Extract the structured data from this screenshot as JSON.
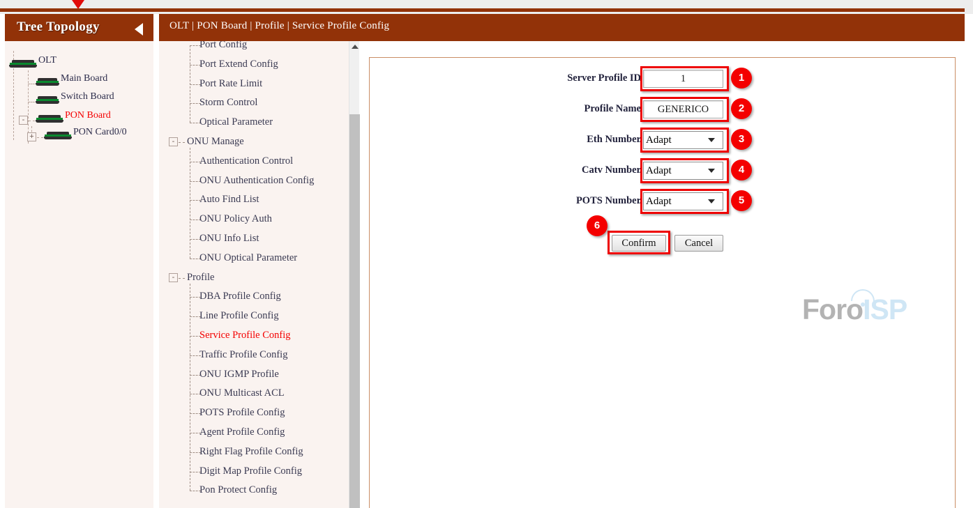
{
  "window": {
    "accent_brown": "#923208",
    "highlight_red": "#f40000",
    "panel_cream": "#faf3f0"
  },
  "tree": {
    "title": "Tree Topology",
    "collapse_icon": "triangle-left-icon",
    "nodes": [
      {
        "label": "OLT",
        "icon": "board-icon",
        "expander": "",
        "active": false
      },
      {
        "label": "Main Board",
        "icon": "board-icon",
        "expander": "",
        "active": false
      },
      {
        "label": "Switch Board",
        "icon": "board-icon",
        "expander": "",
        "active": false
      },
      {
        "label": "PON Board",
        "icon": "board-icon",
        "expander": "-",
        "active": true
      },
      {
        "label": "PON Card0/0",
        "icon": "board-icon",
        "expander": "+",
        "active": false
      }
    ]
  },
  "header": {
    "breadcrumb": "OLT | PON Board | Profile | Service Profile Config"
  },
  "nav": {
    "items": [
      {
        "label": "Port Config",
        "type": "leaf",
        "active": false
      },
      {
        "label": "Port Extend Config",
        "type": "leaf",
        "active": false
      },
      {
        "label": "Port Rate Limit",
        "type": "leaf",
        "active": false
      },
      {
        "label": "Storm Control",
        "type": "leaf",
        "active": false
      },
      {
        "label": "Optical Parameter",
        "type": "leaf",
        "active": false
      },
      {
        "label": "ONU Manage",
        "type": "group",
        "active": false,
        "expander": "-"
      },
      {
        "label": "Authentication Control",
        "type": "leaf",
        "active": false
      },
      {
        "label": "ONU Authentication Config",
        "type": "leaf",
        "active": false
      },
      {
        "label": "Auto Find List",
        "type": "leaf",
        "active": false
      },
      {
        "label": "ONU Policy Auth",
        "type": "leaf",
        "active": false
      },
      {
        "label": "ONU Info List",
        "type": "leaf",
        "active": false
      },
      {
        "label": "ONU Optical Parameter",
        "type": "leaf",
        "active": false
      },
      {
        "label": "Profile",
        "type": "group",
        "active": false,
        "expander": "-"
      },
      {
        "label": "DBA Profile Config",
        "type": "leaf",
        "active": false
      },
      {
        "label": "Line Profile Config",
        "type": "leaf",
        "active": false
      },
      {
        "label": "Service Profile Config",
        "type": "leaf",
        "active": true
      },
      {
        "label": "Traffic Profile Config",
        "type": "leaf",
        "active": false
      },
      {
        "label": "ONU IGMP Profile",
        "type": "leaf",
        "active": false
      },
      {
        "label": "ONU Multicast ACL",
        "type": "leaf",
        "active": false
      },
      {
        "label": "POTS Profile Config",
        "type": "leaf",
        "active": false
      },
      {
        "label": "Agent Profile Config",
        "type": "leaf",
        "active": false
      },
      {
        "label": "Right Flag Profile Config",
        "type": "leaf",
        "active": false
      },
      {
        "label": "Digit Map Profile Config",
        "type": "leaf",
        "active": false
      },
      {
        "label": "Pon Protect Config",
        "type": "leaf",
        "active": false
      }
    ],
    "scroll_up_icon": "triangle-up-icon"
  },
  "watermark": {
    "text_primary": "Foro",
    "text_secondary": "ISP"
  },
  "form": {
    "fields": [
      {
        "label": "Server Profile ID",
        "colon": ":",
        "control": "text",
        "value": "1",
        "badge": "1"
      },
      {
        "label": "Profile Name",
        "colon": ":",
        "control": "text",
        "value": "GENERICO",
        "badge": "2"
      },
      {
        "label": "Eth Number",
        "colon": ":",
        "control": "select",
        "value": "Adapt",
        "badge": "3"
      },
      {
        "label": "Catv Number",
        "colon": ":",
        "control": "select",
        "value": "Adapt",
        "badge": "4"
      },
      {
        "label": "POTS Number",
        "colon": ":",
        "control": "select",
        "value": "Adapt",
        "badge": "5"
      }
    ],
    "select_options": [
      "Adapt"
    ],
    "confirm_label": "Confirm",
    "cancel_label": "Cancel",
    "confirm_badge": "6"
  }
}
